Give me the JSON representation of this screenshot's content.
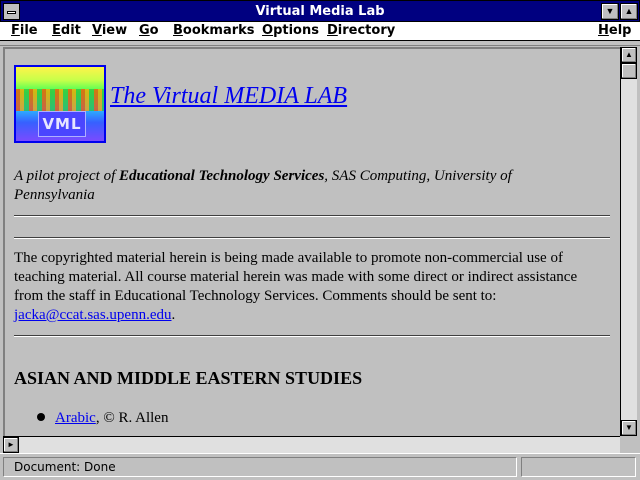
{
  "window": {
    "title": "Virtual Media Lab"
  },
  "titlebar_buttons": {
    "minimize": "▼",
    "maximize": "▲"
  },
  "menubar": {
    "items": [
      "File",
      "Edit",
      "View",
      "Go",
      "Bookmarks",
      "Options",
      "Directory"
    ],
    "help": "Help"
  },
  "page": {
    "logo_text": "VML",
    "title": "The Virtual MEDIA LAB",
    "subtitle_prefix": "A pilot project of ",
    "subtitle_org": "Educational Technology Services",
    "subtitle_suffix": ", SAS Computing, University of Pennsylvania",
    "notice": "The copyrighted material herein is being made available to promote non-commercial use of teaching material. All course material herein was made with some direct or indirect assistance from the staff in Educational Technology Services. Comments should be sent to: ",
    "email": "jacka@ccat.sas.upenn.edu",
    "email_suffix": ".",
    "section_heading": "ASIAN AND MIDDLE EASTERN STUDIES",
    "list_items": [
      {
        "link": "Arabic",
        "credit": ", © R. Allen"
      }
    ]
  },
  "scrollbars": {
    "up": "▲",
    "down": "▼",
    "left": "◄",
    "right": "►"
  },
  "status": {
    "text": "Document: Done"
  },
  "colors": {
    "titlebar": "#000080",
    "link": "#0000ee",
    "background": "#c0c0c0"
  }
}
